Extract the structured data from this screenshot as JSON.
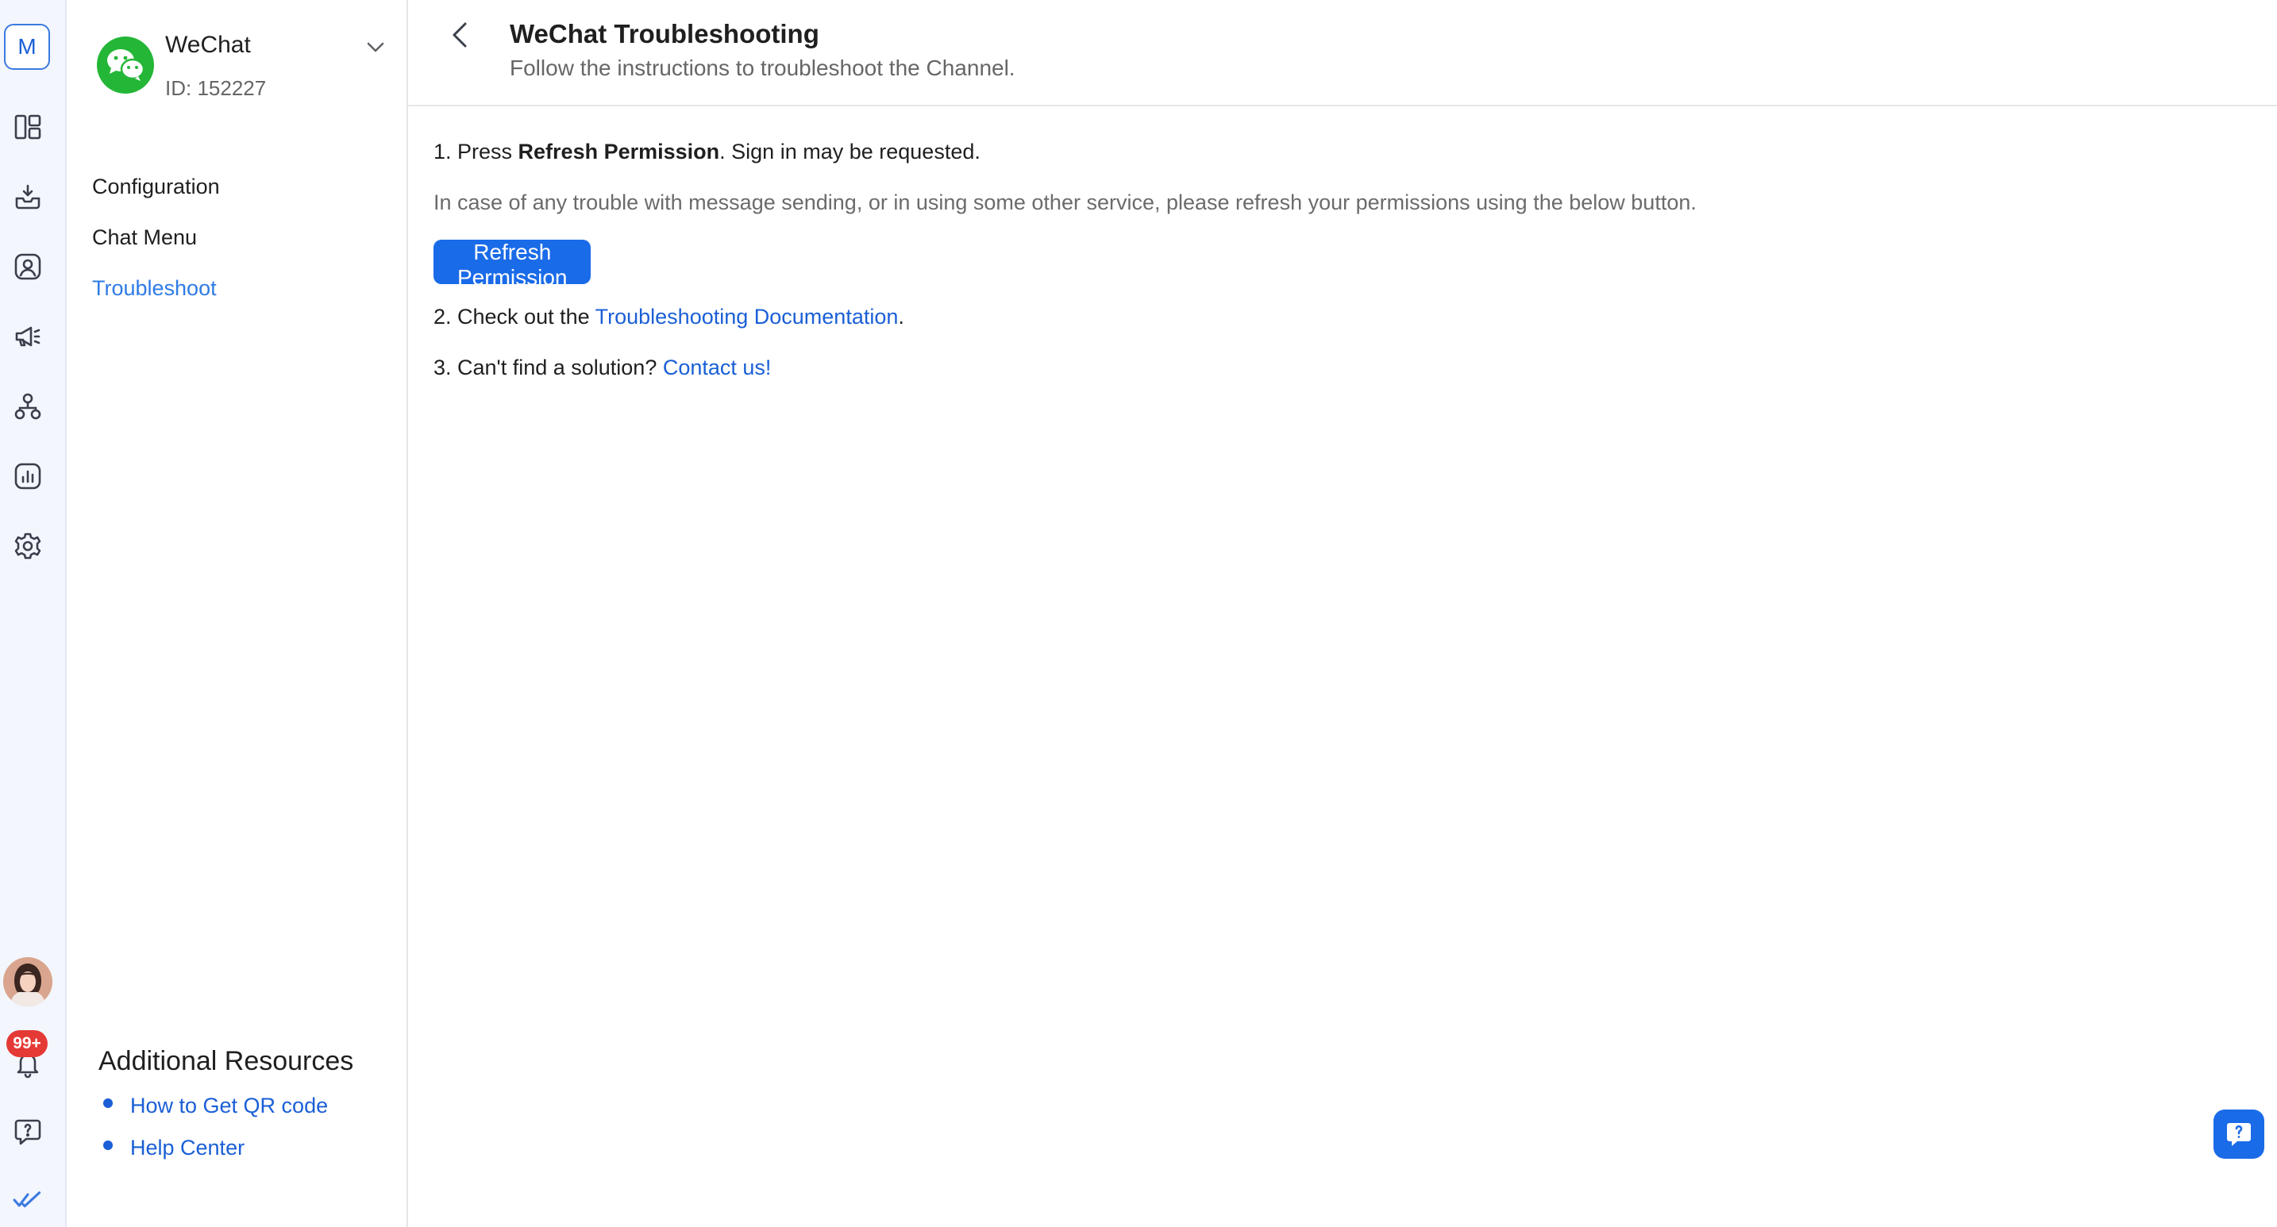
{
  "rail": {
    "workspace_initial": "M",
    "badge": "99+",
    "icons": [
      "dashboard-icon",
      "inbox-icon",
      "contacts-icon",
      "broadcast-icon",
      "workflows-icon",
      "reports-icon",
      "settings-icon",
      "notifications-icon",
      "help-icon",
      "logo-icon"
    ]
  },
  "sidebar": {
    "channel_name": "WeChat",
    "channel_id": "ID: 152227",
    "items": [
      {
        "label": "Configuration"
      },
      {
        "label": "Chat Menu"
      },
      {
        "label": "Troubleshoot",
        "active": true
      }
    ],
    "resources_title": "Additional Resources",
    "resources": [
      {
        "label": "How to Get QR code"
      },
      {
        "label": "Help Center"
      }
    ]
  },
  "header": {
    "title": "WeChat Troubleshooting",
    "subtitle": "Follow the instructions to troubleshoot the Channel."
  },
  "content": {
    "step1_prefix": "1. Press ",
    "step1_bold": "Refresh Permission",
    "step1_suffix": ". Sign in may be requested.",
    "note": "In case of any trouble with message sending, or in using some other service, please refresh your permissions using the below button.",
    "refresh_button": "Refresh Permission",
    "step2_prefix": "2. Check out the ",
    "step2_link": "Troubleshooting Documentation",
    "step2_suffix": ".",
    "step3_prefix": "3. Can't find a solution? ",
    "step3_link": "Contact us!"
  },
  "colors": {
    "accent": "#1a6be8",
    "link": "#1a5fd6",
    "active_nav": "#2f7be6",
    "wechat_green": "#24b636",
    "badge_red": "#e53935",
    "rail_bg": "#f3f6fd"
  }
}
